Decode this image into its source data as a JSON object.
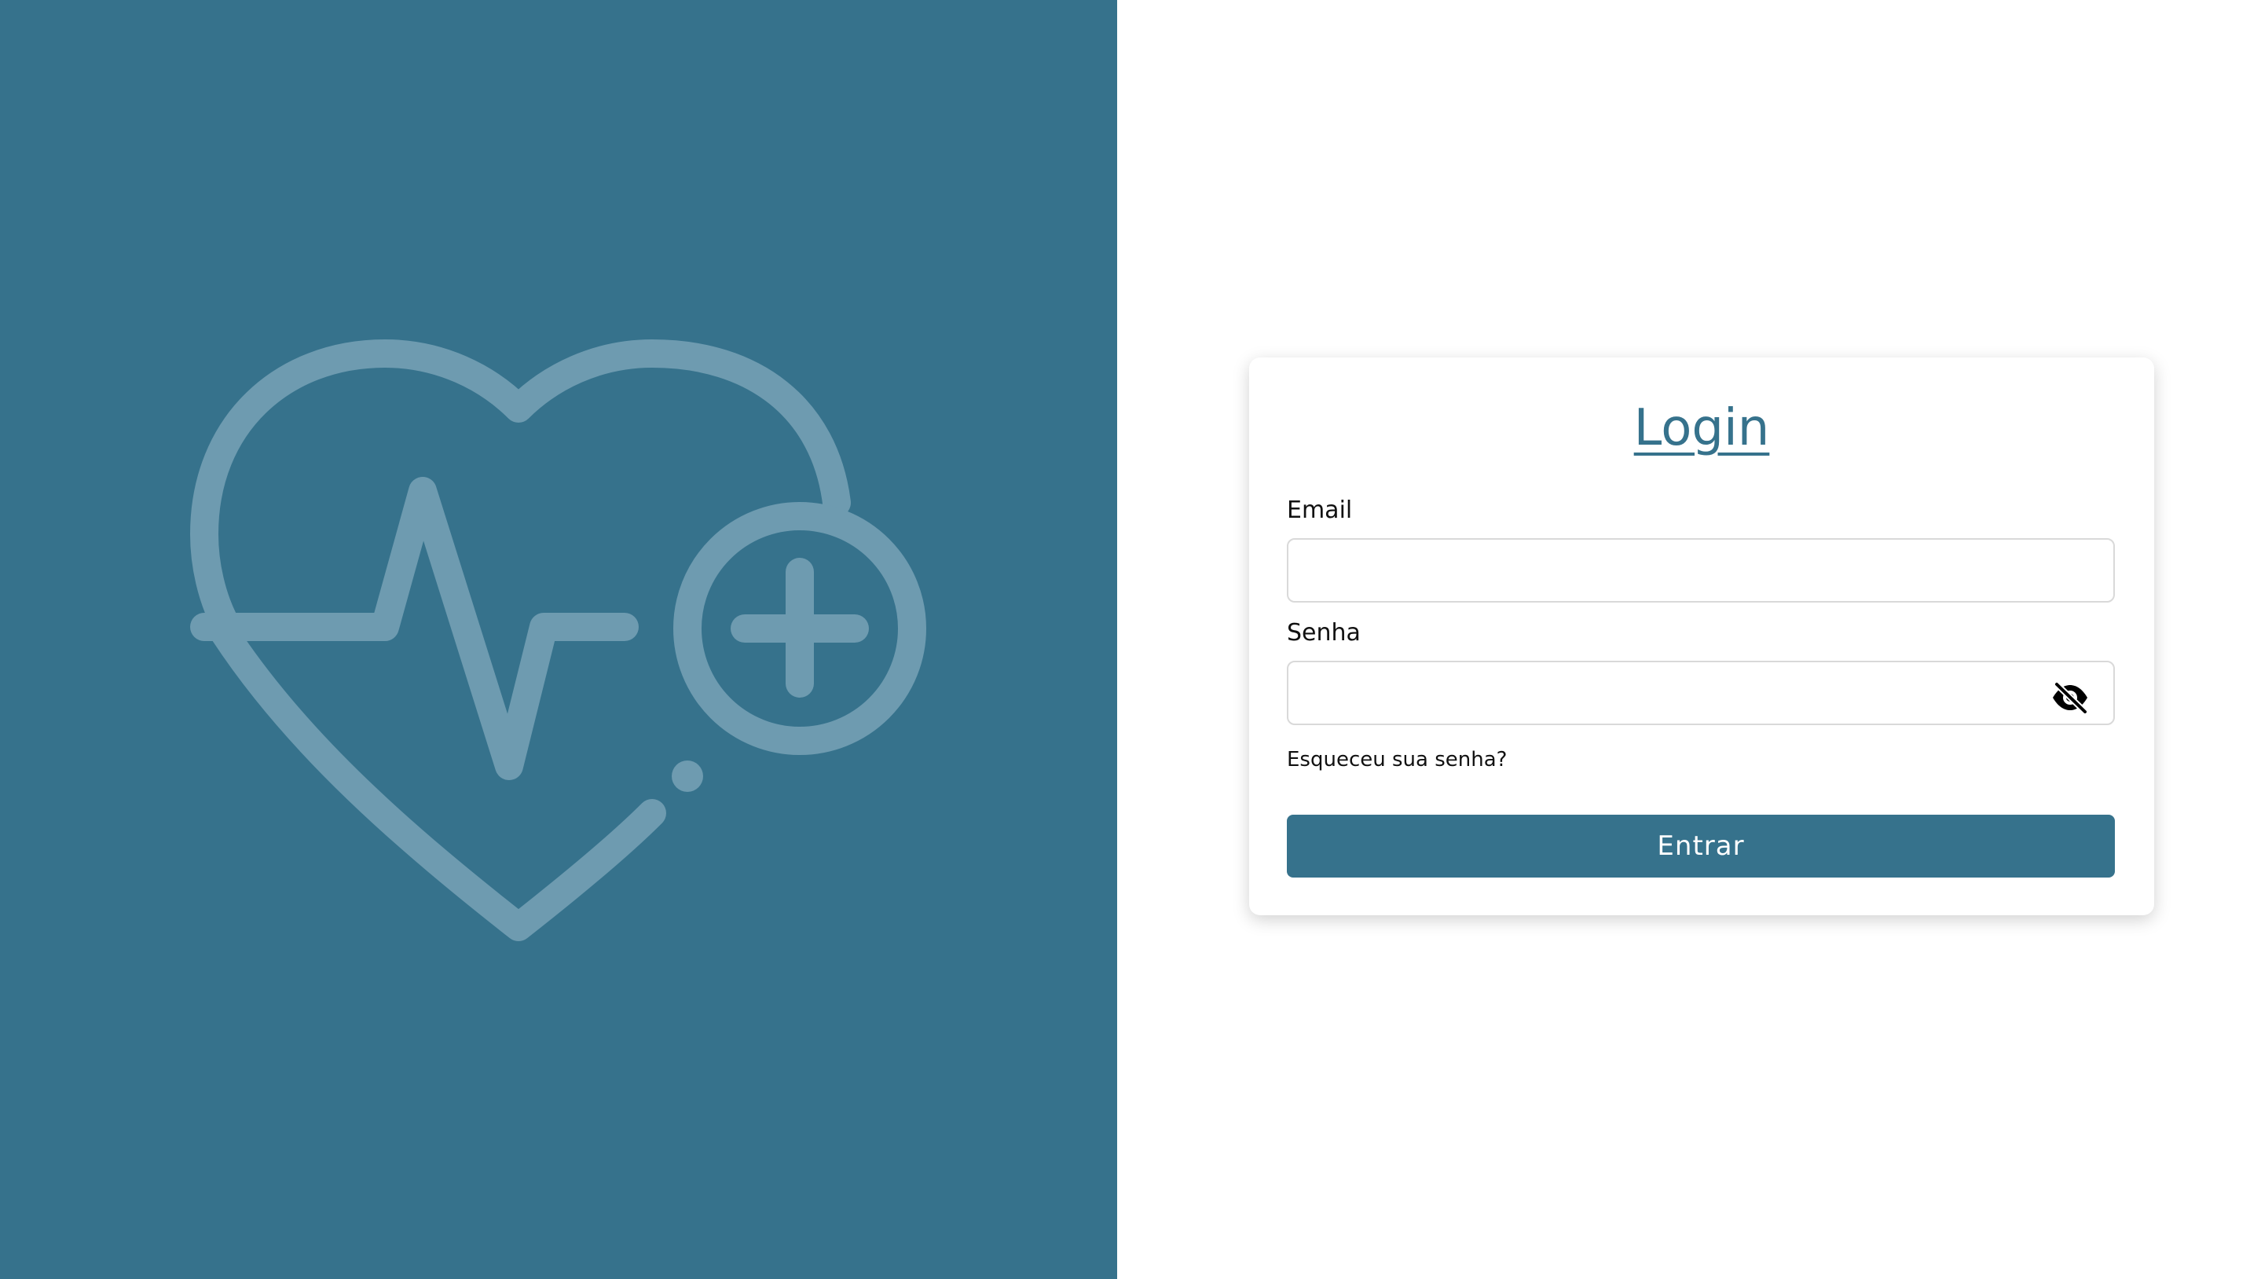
{
  "brand": {
    "panel_color": "#36728c",
    "logo_icon": "heart-pulse-plus-icon",
    "logo_color": "#6e9bb0"
  },
  "login": {
    "title": "Login",
    "email_label": "Email",
    "email_value": "",
    "password_label": "Senha",
    "password_value": "",
    "password_toggle_icon": "eye-off-icon",
    "forgot_password": "Esqueceu sua senha?",
    "submit_label": "Entrar"
  }
}
